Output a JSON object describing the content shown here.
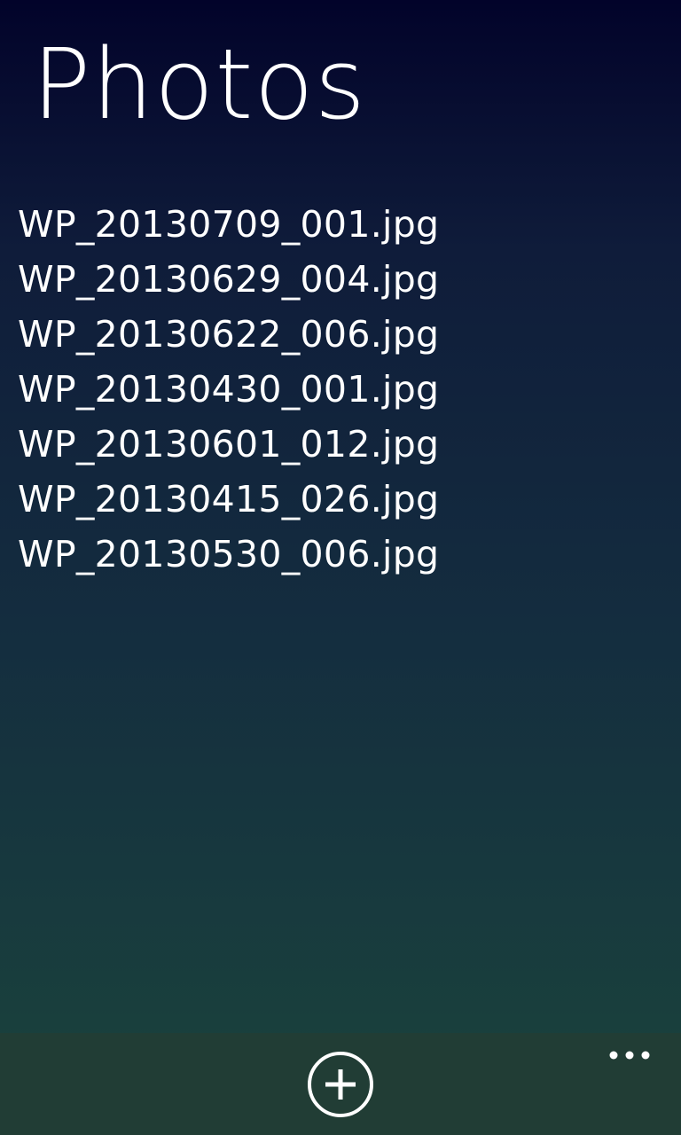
{
  "header": {
    "title": "Photos"
  },
  "files": [
    {
      "name": "WP_20130709_001.jpg"
    },
    {
      "name": "WP_20130629_004.jpg"
    },
    {
      "name": "WP_20130622_006.jpg"
    },
    {
      "name": "WP_20130430_001.jpg"
    },
    {
      "name": "WP_20130601_012.jpg"
    },
    {
      "name": "WP_20130415_026.jpg"
    },
    {
      "name": "WP_20130530_006.jpg"
    }
  ],
  "app_bar": {
    "add_icon": "add-circle-icon",
    "more_icon": "ellipsis-icon"
  },
  "colors": {
    "background_top": "#02032a",
    "background_bottom": "#1a433c",
    "app_bar": "#213d35",
    "text": "#ffffff"
  }
}
